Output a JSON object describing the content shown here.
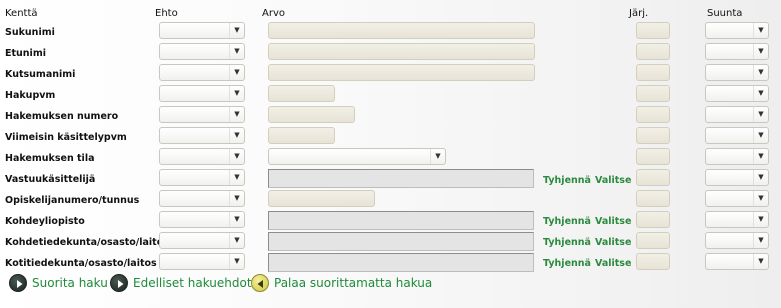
{
  "headers": {
    "field": "Kenttä",
    "condition": "Ehto",
    "value": "Arvo",
    "order": "Järj.",
    "direction": "Suunta"
  },
  "actions": {
    "clear": "Tyhjennä",
    "choose": "Valitse"
  },
  "rows": [
    {
      "label": "Sukunimi"
    },
    {
      "label": "Etunimi"
    },
    {
      "label": "Kutsumanimi"
    },
    {
      "label": "Hakupvm"
    },
    {
      "label": "Hakemuksen numero"
    },
    {
      "label": "Viimeisin käsittelypvm"
    },
    {
      "label": "Hakemuksen tila"
    },
    {
      "label": "Vastuukäsittelijä"
    },
    {
      "label": "Opiskelijanumero/tunnus"
    },
    {
      "label": "Kohdeyliopisto"
    },
    {
      "label": "Kohdetiedekunta/osasto/laitos"
    },
    {
      "label": "Kotitiedekunta/osasto/laitos"
    }
  ],
  "buttons": {
    "search": "Suorita haku",
    "previous": "Edelliset hakuehdot",
    "back": "Palaa suorittamatta hakua"
  }
}
